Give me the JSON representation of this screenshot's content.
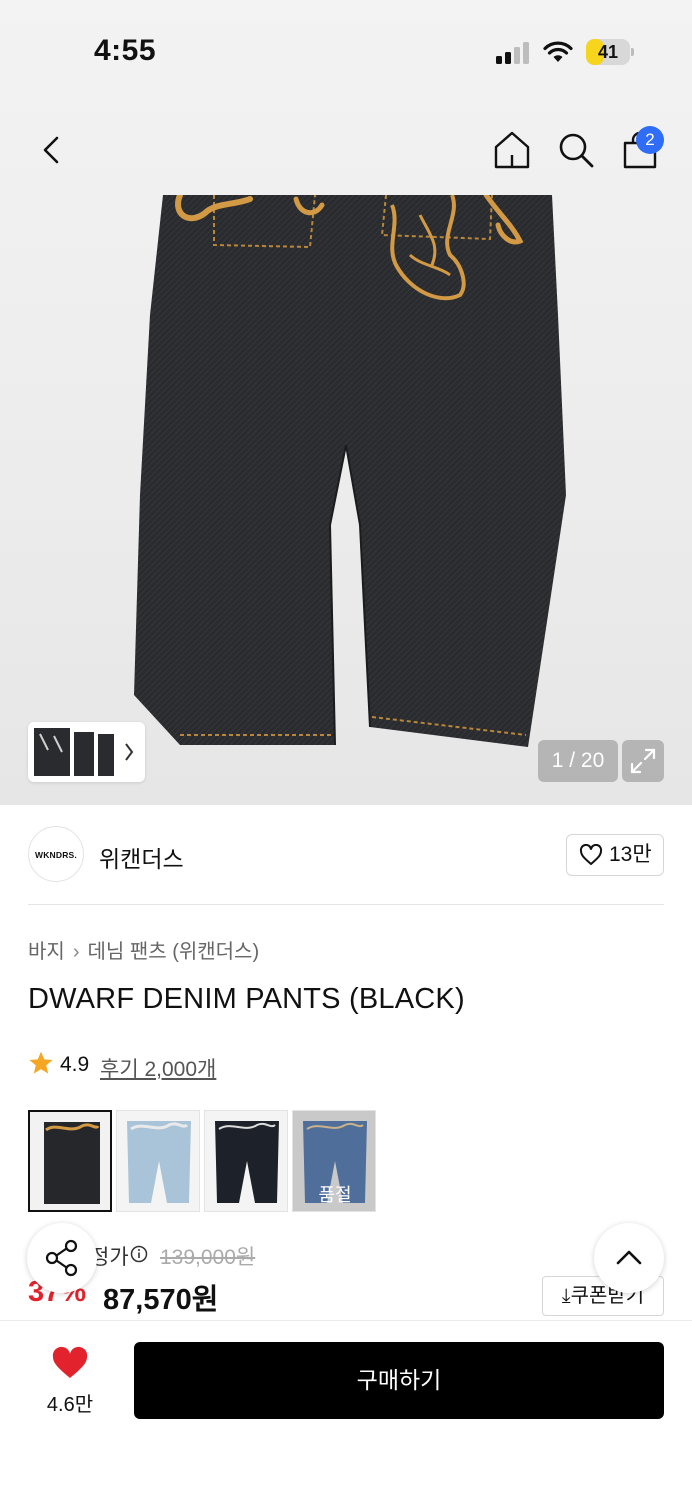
{
  "status_bar": {
    "time": "4:55",
    "battery": "41",
    "battery_level": 0.41
  },
  "nav": {
    "cart_count": "2"
  },
  "gallery": {
    "counter": "1 / 20"
  },
  "brand": {
    "logo_text": "WKNDRS.",
    "name": "위캔더스",
    "likes": "13만"
  },
  "breadcrumb": {
    "category": "바지",
    "subcategory": "데님 팬츠 (위캔더스)"
  },
  "product": {
    "title": "DWARF DENIM PANTS (BLACK)",
    "rating": "4.9",
    "reviews": "후기 2,000개"
  },
  "variants": [
    {
      "name": "black",
      "soldout": false
    },
    {
      "name": "light-blue",
      "soldout": false
    },
    {
      "name": "dark-navy",
      "soldout": false
    },
    {
      "name": "blue",
      "soldout": true,
      "label": "품절"
    }
  ],
  "price": {
    "label_partial": "정가",
    "original": "139,000원",
    "discount": "37%",
    "sale": "87,570원",
    "coupon_label": "쿠폰받기"
  },
  "bottom": {
    "wish_count": "4.6만",
    "buy_label": "구매하기"
  },
  "colors": {
    "accent_red": "#e2232e",
    "badge_blue": "#2f6df6",
    "battery_yellow": "#f6d51c"
  }
}
